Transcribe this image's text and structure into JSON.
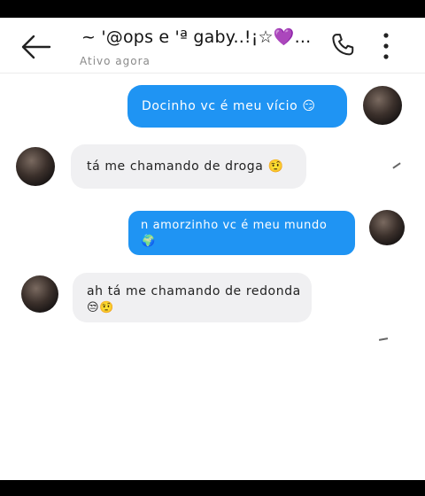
{
  "header": {
    "title": "~ '@ops e 'ª gaby..!¡☆💜...",
    "status": "Ativo agora"
  },
  "messages": [
    {
      "direction": "outgoing",
      "text": "Docinho vc é meu vício 😏"
    },
    {
      "direction": "incoming",
      "text": "tá me chamando de droga 🤨"
    },
    {
      "direction": "outgoing",
      "text_line1": "n amorzinho vc é meu mundo",
      "text_line2": "🌍"
    },
    {
      "direction": "incoming",
      "text_line1": "ah tá me chamando de redonda",
      "text_line2": "😒🤨"
    }
  ],
  "icons": {
    "back": "arrow-left-icon",
    "call": "phone-icon",
    "menu": "more-vertical-icon"
  },
  "colors": {
    "outgoing_bubble": "#1f94f3",
    "incoming_bubble": "#f0f0f2"
  }
}
